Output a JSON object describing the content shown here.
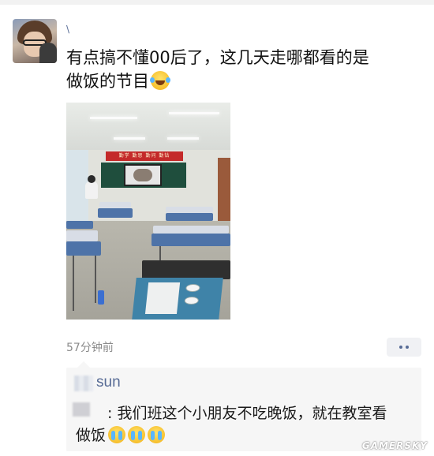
{
  "post": {
    "username": "\\",
    "text_line1": "有点搞不懂00后了，这几天走哪都看的是",
    "text_line2": "做饭的节目",
    "emoji": "laughing-tears-emoji",
    "photo": {
      "banner_text": "勤学 勤思 勤问 勤钻"
    },
    "time": "57分钟前"
  },
  "comments": {
    "liker_name": "sun",
    "comment_line1": ": 我们班这个小朋友不吃晚饭，就在教室看",
    "comment_line2": "做饭",
    "emoji": "crying-emoji"
  },
  "watermark": "GAMERSKY",
  "colors": {
    "link": "#576b95",
    "time": "#8b8b8b",
    "comment_bg": "#f6f6f6"
  }
}
